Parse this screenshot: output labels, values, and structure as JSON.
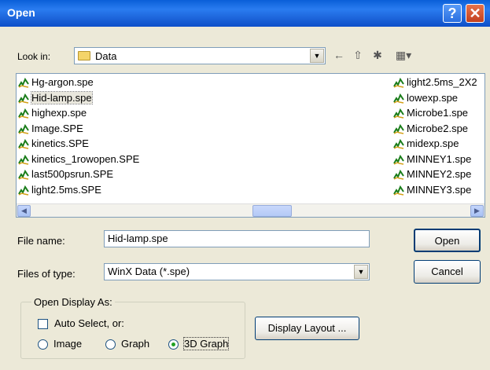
{
  "window": {
    "title": "Open"
  },
  "titlebar": {
    "help_glyph": "?",
    "close_glyph": "✕"
  },
  "lookin": {
    "label": "Look in:",
    "value": "Data"
  },
  "files": {
    "col1": [
      "Hg-argon.spe",
      "Hid-lamp.spe",
      "highexp.spe",
      "Image.SPE",
      "kinetics.SPE",
      "kinetics_1rowopen.SPE",
      "last500psrun.SPE",
      "light2.5ms.SPE"
    ],
    "col2": [
      "light2.5ms_2X2",
      "lowexp.spe",
      "Microbe1.spe",
      "Microbe2.spe",
      "midexp.spe",
      "MINNEY1.spe",
      "MINNEY2.spe",
      "MINNEY3.spe"
    ],
    "selected": "Hid-lamp.spe"
  },
  "filename": {
    "label": "File name:",
    "value": "Hid-lamp.spe"
  },
  "filetype": {
    "label": "Files of type:",
    "value": "WinX Data (*.spe)"
  },
  "buttons": {
    "open": "Open",
    "cancel": "Cancel",
    "display_layout": "Display Layout ..."
  },
  "display_as": {
    "title": "Open Display As:",
    "auto_select": "Auto Select,  or:",
    "image": "Image",
    "graph": "Graph",
    "graph3d": "3D Graph",
    "selected": "3D Graph"
  },
  "colors": {
    "title_bar": "#1c63d9",
    "dialog_bg": "#ece9d8",
    "selection": "#e9e7dd"
  }
}
